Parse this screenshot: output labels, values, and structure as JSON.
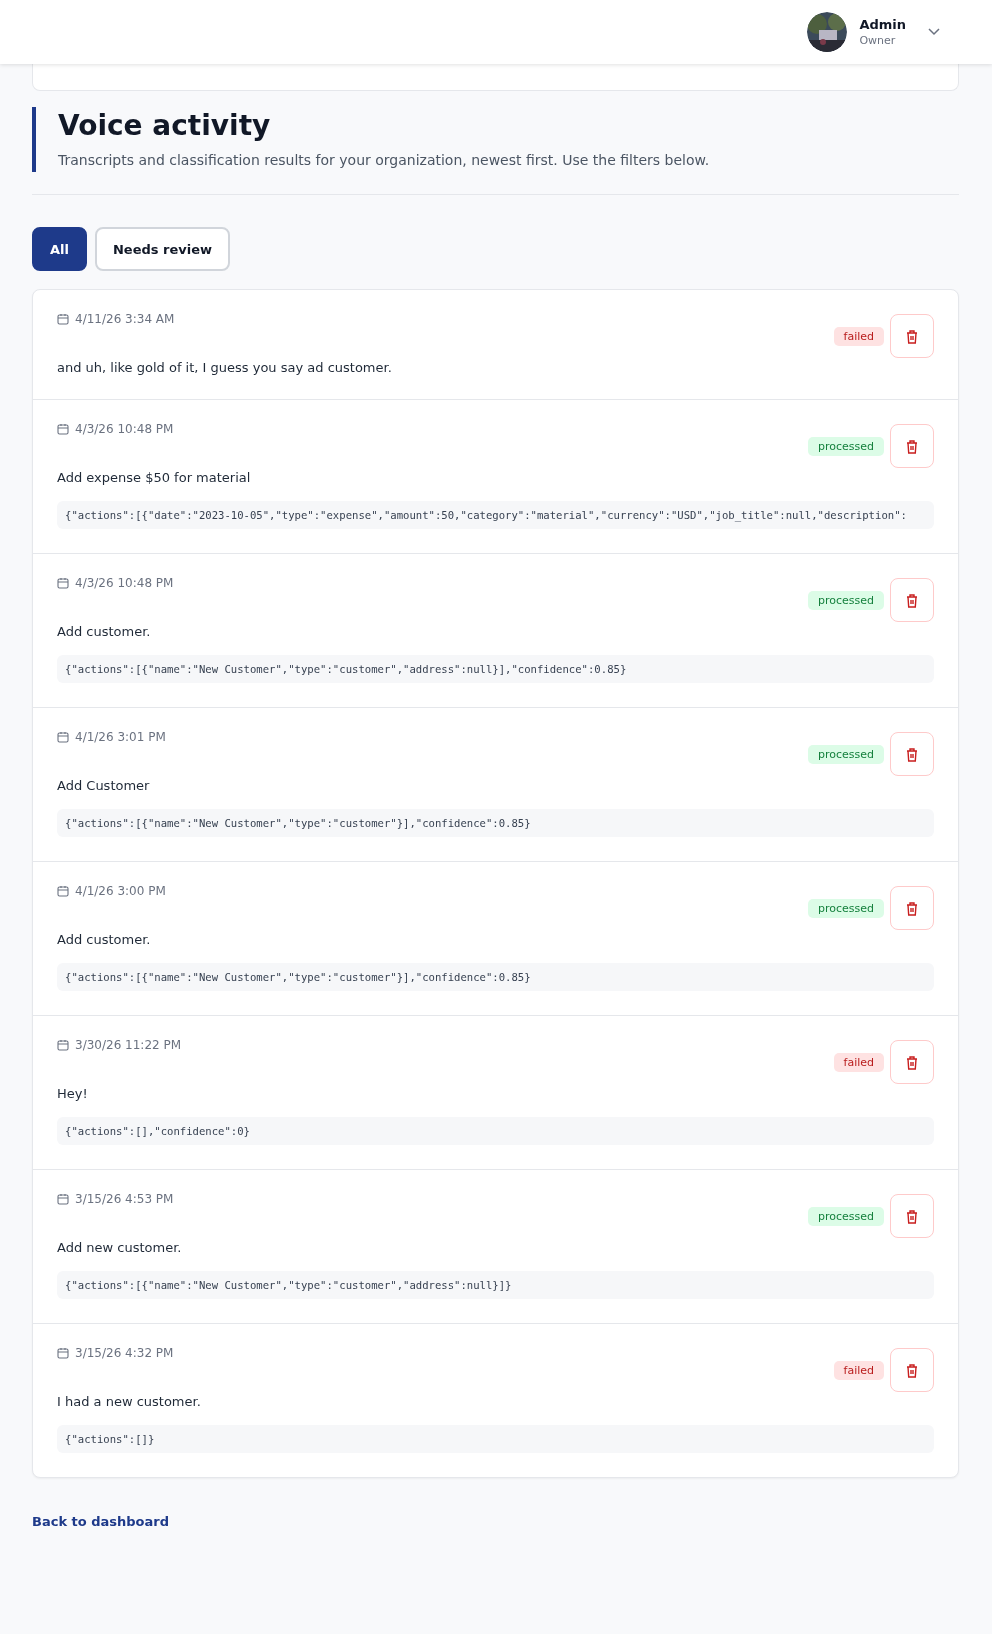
{
  "user": {
    "name": "Admin",
    "role": "Owner"
  },
  "page": {
    "title": "Voice activity",
    "subtitle": "Transcripts and classification results for your organization, newest first. Use the filters below."
  },
  "filters": [
    {
      "label": "All",
      "selected": true
    },
    {
      "label": "Needs review",
      "selected": false
    }
  ],
  "entries": [
    {
      "date": "4/11/26 3:34 AM",
      "status": "failed",
      "transcript": "and uh, like gold of it, I guess you say ad customer."
    },
    {
      "date": "4/3/26 10:48 PM",
      "status": "processed",
      "transcript": "Add expense $50 for material",
      "result": "{\"actions\":[{\"date\":\"2023-10-05\",\"type\":\"expense\",\"amount\":50,\"category\":\"material\",\"currency\":\"USD\",\"job_title\":null,\"description\":"
    },
    {
      "date": "4/3/26 10:48 PM",
      "status": "processed",
      "transcript": "Add customer.",
      "result": "{\"actions\":[{\"name\":\"New Customer\",\"type\":\"customer\",\"address\":null}],\"confidence\":0.85}"
    },
    {
      "date": "4/1/26 3:01 PM",
      "status": "processed",
      "transcript": "Add Customer",
      "result": "{\"actions\":[{\"name\":\"New Customer\",\"type\":\"customer\"}],\"confidence\":0.85}"
    },
    {
      "date": "4/1/26 3:00 PM",
      "status": "processed",
      "transcript": "Add customer.",
      "result": "{\"actions\":[{\"name\":\"New Customer\",\"type\":\"customer\"}],\"confidence\":0.85}"
    },
    {
      "date": "3/30/26 11:22 PM",
      "status": "failed",
      "transcript": "Hey!",
      "result": "{\"actions\":[],\"confidence\":0}"
    },
    {
      "date": "3/15/26 4:53 PM",
      "status": "processed",
      "transcript": "Add new customer.",
      "result": "{\"actions\":[{\"name\":\"New Customer\",\"type\":\"customer\",\"address\":null}]}"
    },
    {
      "date": "3/15/26 4:32 PM",
      "status": "failed",
      "transcript": "I had a new customer.",
      "result": "{\"actions\":[]}"
    }
  ],
  "back_link": "Back to dashboard"
}
